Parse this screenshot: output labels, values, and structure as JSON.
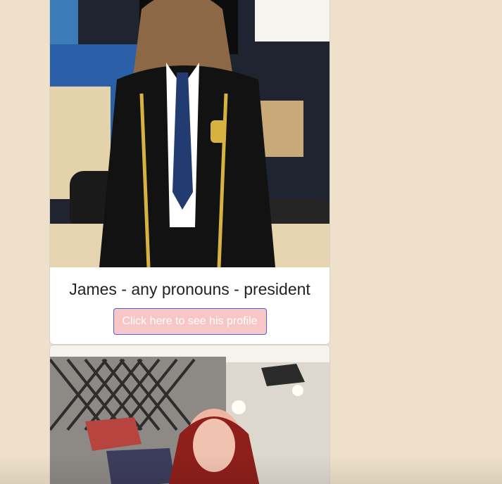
{
  "cards": [
    {
      "photo_label": "photo-james",
      "title": "James - any pronouns - president",
      "button_label": "Click here to see his profile"
    },
    {
      "photo_label": "photo-member"
    }
  ],
  "colors": {
    "page_background": "#eee0ca",
    "card_background": "#ffffff",
    "button_background": "#f7c6c6",
    "button_border": "#5061d1",
    "button_text": "#ffffff",
    "title_text": "#222222"
  },
  "icons": {
    "photo_icon": "photo-icon"
  }
}
